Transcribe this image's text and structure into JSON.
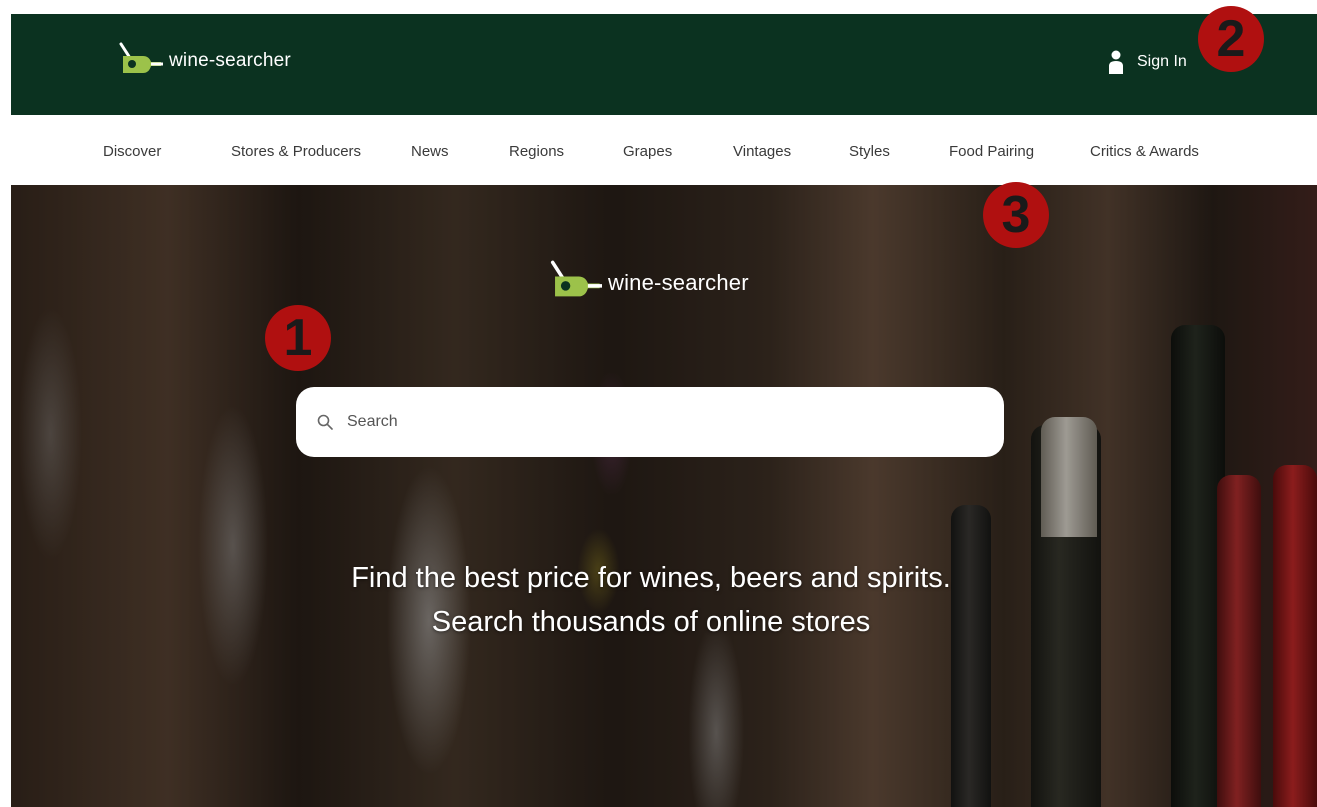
{
  "brand": {
    "name": "wine-searcher",
    "logo_color": "#9cc24a",
    "header_bg": "#0b3220"
  },
  "header": {
    "signin_label": "Sign In"
  },
  "nav": {
    "items": [
      "Discover",
      "Stores & Producers",
      "News",
      "Regions",
      "Grapes",
      "Vintages",
      "Styles",
      "Food Pairing",
      "Critics & Awards"
    ]
  },
  "hero": {
    "search_placeholder": "Search",
    "tagline_line1": "Find the best price for wines, beers and spirits.",
    "tagline_line2": "Search thousands of online stores"
  },
  "markers": [
    {
      "label": "1"
    },
    {
      "label": "2"
    },
    {
      "label": "3"
    }
  ],
  "marker_color": "#b01010"
}
